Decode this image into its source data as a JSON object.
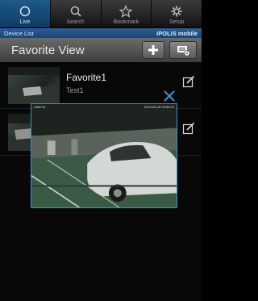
{
  "tabs": [
    {
      "label": "Live",
      "icon": "circle-icon",
      "active": true
    },
    {
      "label": "Search",
      "icon": "search-icon",
      "active": false
    },
    {
      "label": "Bookmark",
      "icon": "star-icon",
      "active": false
    },
    {
      "label": "Setup",
      "icon": "gear-icon",
      "active": false
    }
  ],
  "section": {
    "left": "Device List",
    "right": "iPOLiS mobile"
  },
  "titlebar": {
    "title": "Favorite View",
    "add_icon": "plus-icon",
    "view_icon": "camera-settings-icon"
  },
  "favorites": [
    {
      "name": "Favorite1",
      "sub": "Test1",
      "edit_icon": "edit-icon"
    },
    {
      "name": "",
      "sub": "",
      "edit_icon": "edit-icon"
    }
  ],
  "preview": {
    "cam_label": "CAM 01",
    "timestamp": "2013-03-15 09:50:21",
    "close_icon": "close-icon"
  },
  "colors": {
    "accent": "#3c8fd6",
    "tab_active": "#1f5a8a",
    "section": "#2c5d92"
  }
}
